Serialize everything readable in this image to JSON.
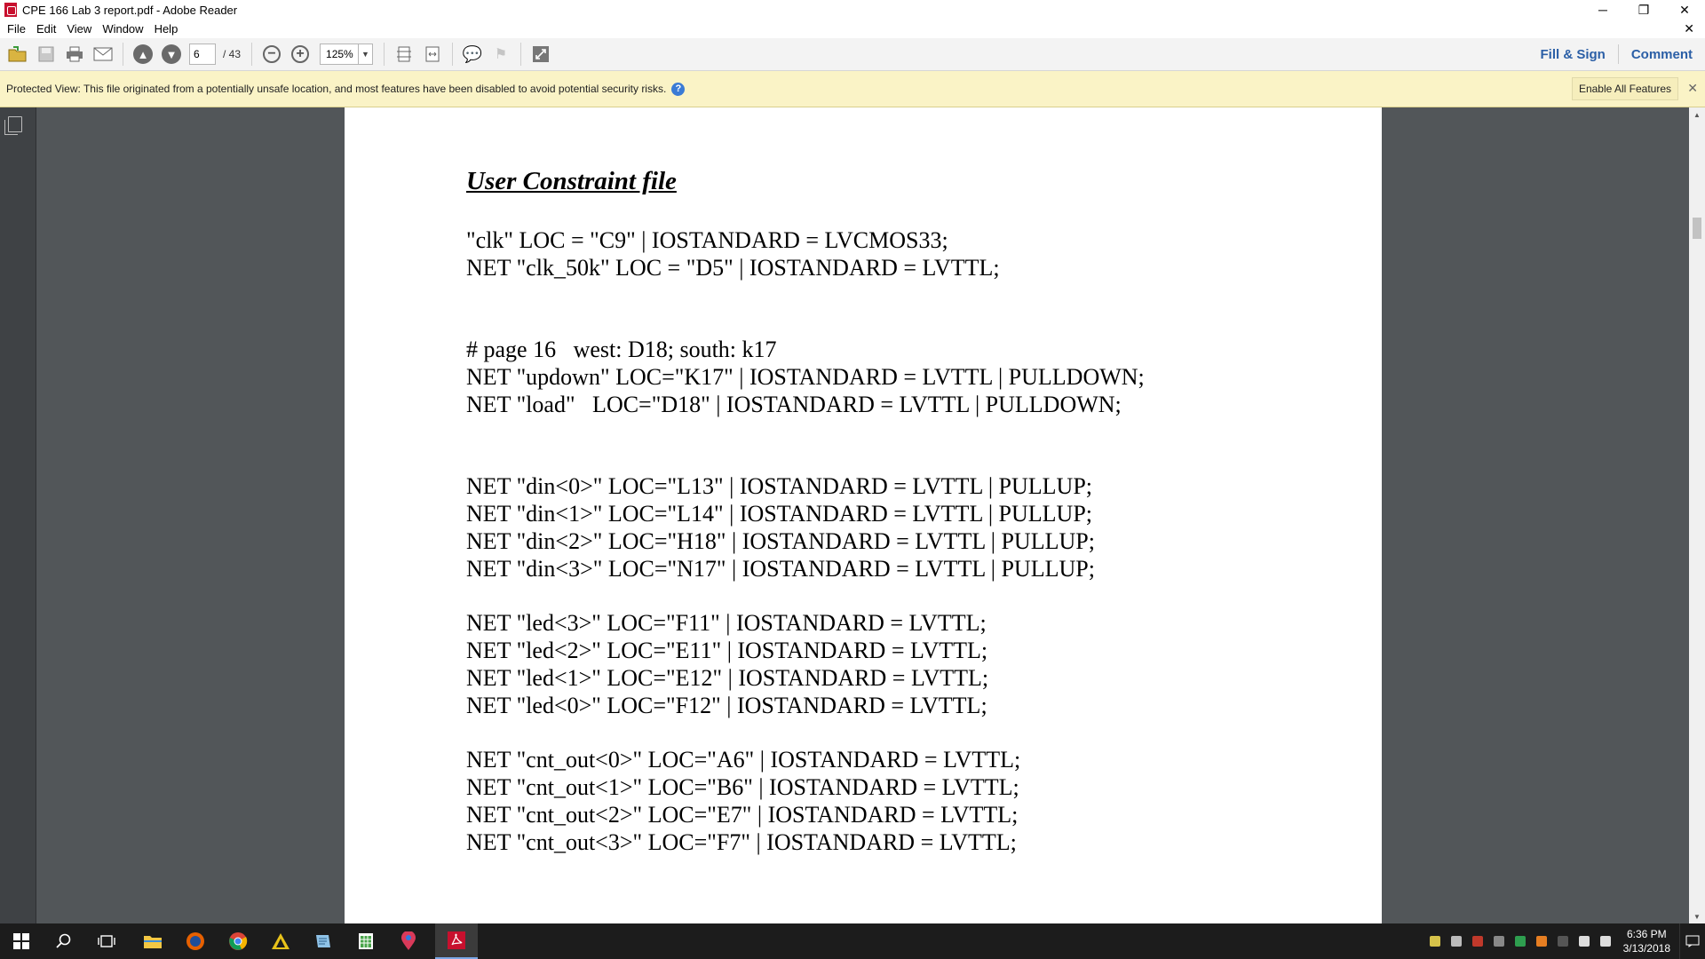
{
  "window": {
    "title": "CPE 166 Lab 3 report.pdf - Adobe Reader",
    "minimize": "─",
    "maximize": "❐",
    "close": "✕"
  },
  "menu": {
    "items": [
      "File",
      "Edit",
      "View",
      "Window",
      "Help"
    ],
    "close_doc": "✕"
  },
  "toolbar": {
    "page_current": "6",
    "page_total": "/ 43",
    "zoom": "125%",
    "fill_sign": "Fill & Sign",
    "comment": "Comment"
  },
  "protected_view": {
    "message": "Protected View: This file originated from a potentially unsafe location, and most features have been disabled to avoid potential security risks.",
    "help": "?",
    "enable_button": "Enable All Features",
    "close": "✕",
    "bg_color": "#faf3c6"
  },
  "document": {
    "heading": "User Constraint file",
    "lines": [
      "\"clk\" LOC = \"C9\" | IOSTANDARD = LVCMOS33;",
      "NET \"clk_50k\" LOC = \"D5\" | IOSTANDARD = LVTTL;",
      "",
      "",
      "# page 16   west: D18; south: k17",
      "NET \"updown\" LOC=\"K17\" | IOSTANDARD = LVTTL | PULLDOWN;",
      "NET \"load\"   LOC=\"D18\" | IOSTANDARD = LVTTL | PULLDOWN;",
      "",
      "",
      "NET \"din<0>\" LOC=\"L13\" | IOSTANDARD = LVTTL | PULLUP;",
      "NET \"din<1>\" LOC=\"L14\" | IOSTANDARD = LVTTL | PULLUP;",
      "NET \"din<2>\" LOC=\"H18\" | IOSTANDARD = LVTTL | PULLUP;",
      "NET \"din<3>\" LOC=\"N17\" | IOSTANDARD = LVTTL | PULLUP;",
      "",
      "NET \"led<3>\" LOC=\"F11\" | IOSTANDARD = LVTTL;",
      "NET \"led<2>\" LOC=\"E11\" | IOSTANDARD = LVTTL;",
      "NET \"led<1>\" LOC=\"E12\" | IOSTANDARD = LVTTL;",
      "NET \"led<0>\" LOC=\"F12\" | IOSTANDARD = LVTTL;",
      "",
      "NET \"cnt_out<0>\" LOC=\"A6\" | IOSTANDARD = LVTTL;",
      "NET \"cnt_out<1>\" LOC=\"B6\" | IOSTANDARD = LVTTL;",
      "NET \"cnt_out<2>\" LOC=\"E7\" | IOSTANDARD = LVTTL;",
      "NET \"cnt_out<3>\" LOC=\"F7\" | IOSTANDARD = LVTTL;"
    ]
  },
  "taskbar": {
    "time": "6:36 PM",
    "date": "3/13/2018",
    "accent_color": "#7aa7e6"
  }
}
